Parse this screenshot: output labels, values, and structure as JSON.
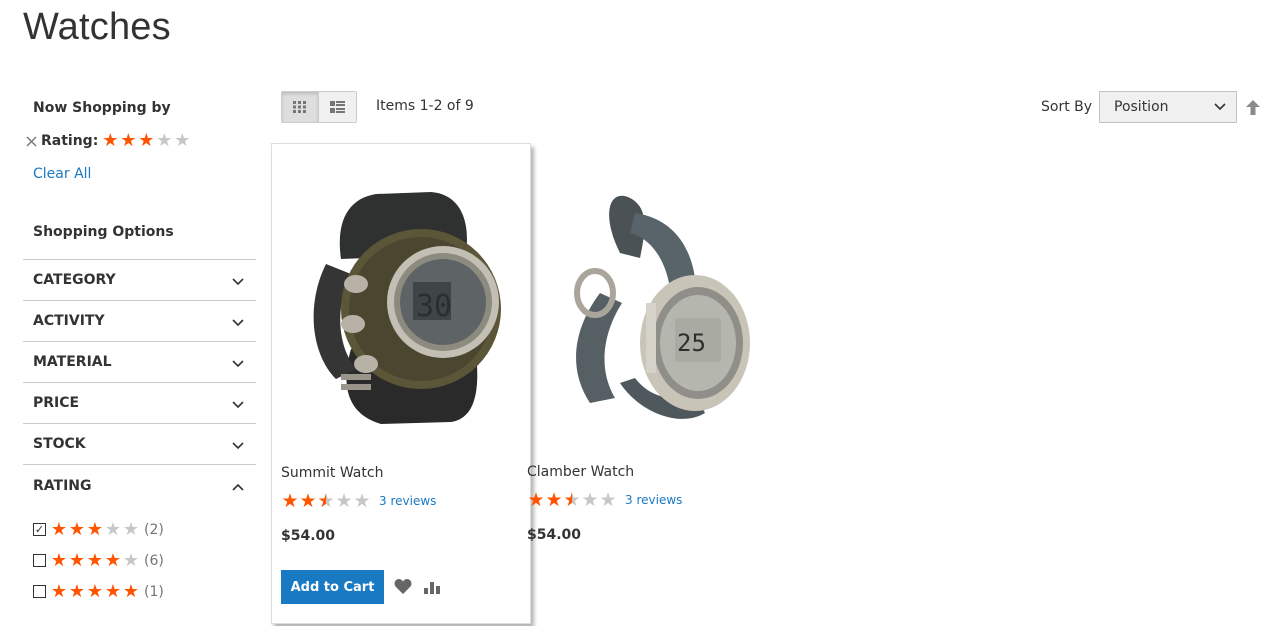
{
  "page": {
    "title": "Watches"
  },
  "sidebar": {
    "now_shopping_title": "Now Shopping by",
    "active_filter": {
      "label": "Rating:",
      "stars_filled": 3,
      "stars_total": 5
    },
    "clear_all": "Clear All",
    "options_title": "Shopping Options",
    "facets": [
      {
        "label": "Category"
      },
      {
        "label": "Activity"
      },
      {
        "label": "Material"
      },
      {
        "label": "Price"
      },
      {
        "label": "Stock"
      },
      {
        "label": "Rating"
      }
    ],
    "rating_options": [
      {
        "stars": 3,
        "count": "(2)",
        "checked": true
      },
      {
        "stars": 4,
        "count": "(6)",
        "checked": false
      },
      {
        "stars": 5,
        "count": "(1)",
        "checked": false
      }
    ]
  },
  "toolbar": {
    "amount": "Items 1-2 of 9",
    "sort_label": "Sort By",
    "sort_value": "Position"
  },
  "products": [
    {
      "name": "Summit Watch",
      "rating": 2.5,
      "reviews": "3 reviews",
      "price": "$54.00",
      "add_to_cart": "Add to Cart"
    },
    {
      "name": "Clamber Watch",
      "rating": 2.5,
      "reviews": "3 reviews",
      "price": "$54.00"
    }
  ],
  "colors": {
    "accent": "#1979c3",
    "star": "#ff5501",
    "star_empty": "#c7c7c7"
  }
}
